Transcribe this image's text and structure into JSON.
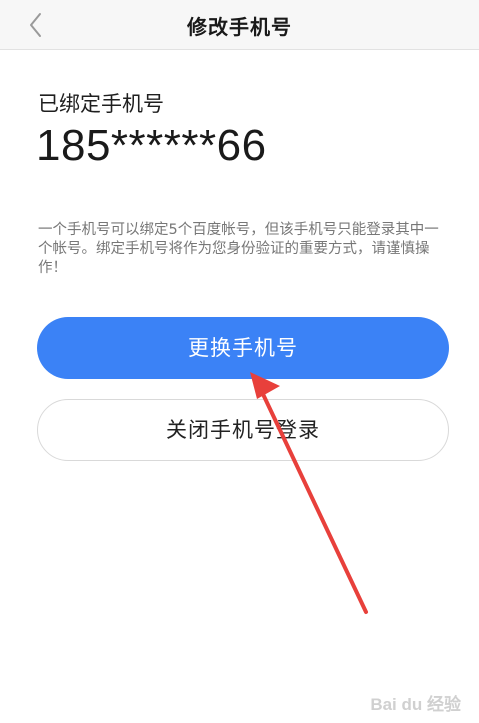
{
  "header": {
    "title": "修改手机号",
    "back_icon": "chevron-left-icon"
  },
  "bound": {
    "label": "已绑定手机号",
    "phone": "185******66"
  },
  "notice": "一个手机号可以绑定5个百度帐号，但该手机号只能登录其中一个帐号。绑定手机号将作为您身份验证的重要方式，请谨慎操作！",
  "actions": {
    "change_label": "更换手机号",
    "close_label": "关闭手机号登录"
  },
  "watermark": "Bai du 经验",
  "colors": {
    "primary": "#3b82f6",
    "arrow": "#e8403b"
  }
}
